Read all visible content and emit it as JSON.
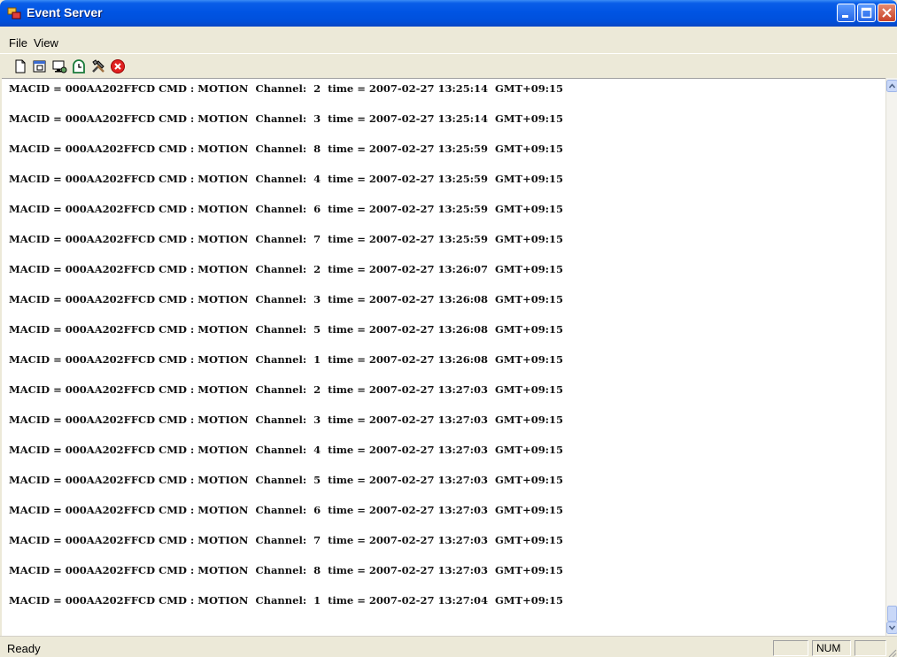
{
  "window": {
    "title": "Event Server"
  },
  "menu": {
    "items": [
      "File",
      "View"
    ]
  },
  "toolbar": {
    "icons": [
      "new-document-icon",
      "window-icon",
      "monitor-icon",
      "clock-icon",
      "tools-icon",
      "stop-icon"
    ]
  },
  "log": [
    "MACID = 000AA202FFCD CMD : MOTION  Channel:  2  time = 2007-02-27 13:25:14  GMT+09:15",
    "MACID = 000AA202FFCD CMD : MOTION  Channel:  3  time = 2007-02-27 13:25:14  GMT+09:15",
    "MACID = 000AA202FFCD CMD : MOTION  Channel:  8  time = 2007-02-27 13:25:59  GMT+09:15",
    "MACID = 000AA202FFCD CMD : MOTION  Channel:  4  time = 2007-02-27 13:25:59  GMT+09:15",
    "MACID = 000AA202FFCD CMD : MOTION  Channel:  6  time = 2007-02-27 13:25:59  GMT+09:15",
    "MACID = 000AA202FFCD CMD : MOTION  Channel:  7  time = 2007-02-27 13:25:59  GMT+09:15",
    "MACID = 000AA202FFCD CMD : MOTION  Channel:  2  time = 2007-02-27 13:26:07  GMT+09:15",
    "MACID = 000AA202FFCD CMD : MOTION  Channel:  3  time = 2007-02-27 13:26:08  GMT+09:15",
    "MACID = 000AA202FFCD CMD : MOTION  Channel:  5  time = 2007-02-27 13:26:08  GMT+09:15",
    "MACID = 000AA202FFCD CMD : MOTION  Channel:  1  time = 2007-02-27 13:26:08  GMT+09:15",
    "MACID = 000AA202FFCD CMD : MOTION  Channel:  2  time = 2007-02-27 13:27:03  GMT+09:15",
    "MACID = 000AA202FFCD CMD : MOTION  Channel:  3  time = 2007-02-27 13:27:03  GMT+09:15",
    "MACID = 000AA202FFCD CMD : MOTION  Channel:  4  time = 2007-02-27 13:27:03  GMT+09:15",
    "MACID = 000AA202FFCD CMD : MOTION  Channel:  5  time = 2007-02-27 13:27:03  GMT+09:15",
    "MACID = 000AA202FFCD CMD : MOTION  Channel:  6  time = 2007-02-27 13:27:03  GMT+09:15",
    "MACID = 000AA202FFCD CMD : MOTION  Channel:  7  time = 2007-02-27 13:27:03  GMT+09:15",
    "MACID = 000AA202FFCD CMD : MOTION  Channel:  8  time = 2007-02-27 13:27:03  GMT+09:15",
    "MACID = 000AA202FFCD CMD : MOTION  Channel:  1  time = 2007-02-27 13:27:04  GMT+09:15"
  ],
  "status": {
    "text": "Ready",
    "num": "NUM"
  }
}
